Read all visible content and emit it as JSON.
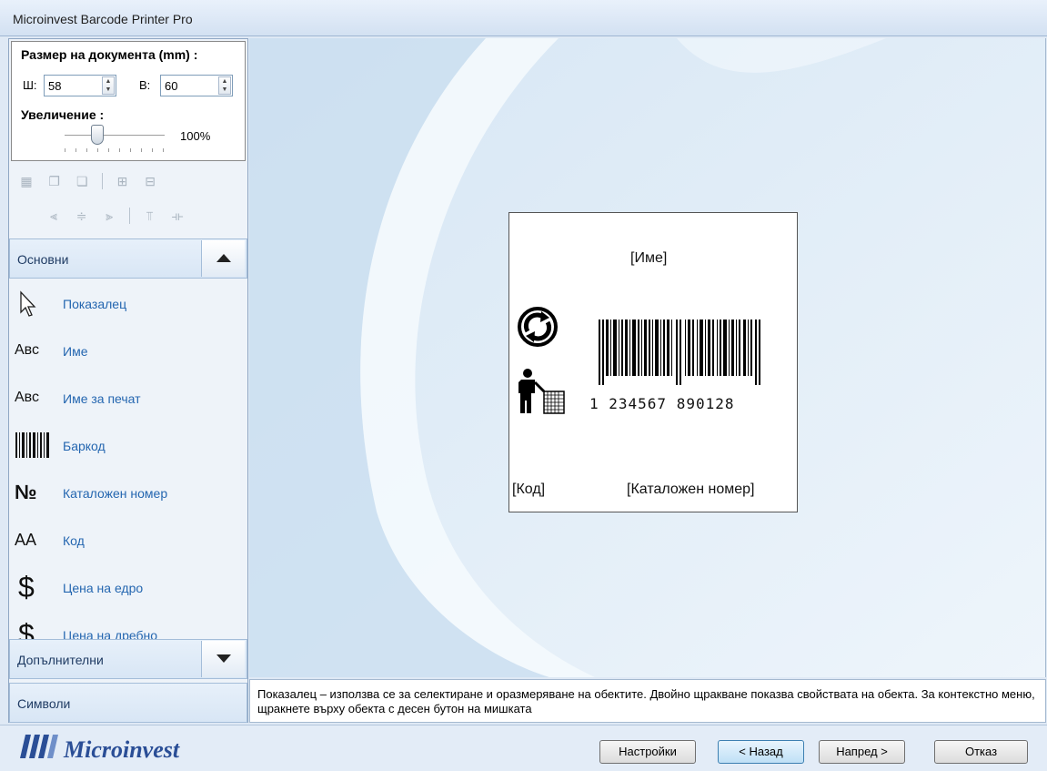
{
  "window": {
    "title": "Microinvest Barcode Printer Pro"
  },
  "doc_size": {
    "title": "Размер на документа (mm) :",
    "width_label": "Ш:",
    "width_value": "58",
    "height_label": "В:",
    "height_value": "60",
    "zoom_label": "Увеличение :",
    "zoom_value_text": "100%",
    "zoom_level": 0.33
  },
  "sections": {
    "basic": "Основни",
    "additional": "Допълнителни",
    "symbols": "Символи"
  },
  "tools": [
    {
      "icon": "pointer-icon",
      "label": "Показалец"
    },
    {
      "icon": "abc-icon",
      "icon_text": "Авс",
      "label": "Име"
    },
    {
      "icon": "abc-icon",
      "icon_text": "Авс",
      "label": "Име за печат"
    },
    {
      "icon": "barcode-icon",
      "label": "Баркод"
    },
    {
      "icon": "numero-icon",
      "icon_text": "№",
      "label": "Каталожен номер"
    },
    {
      "icon": "aa-icon",
      "icon_text": "АА",
      "label": "Код"
    },
    {
      "icon": "dollar-icon",
      "icon_text": "$",
      "label": "Цена на едро"
    },
    {
      "icon": "dollar-icon",
      "icon_text": "$",
      "label": "Цена на дребно"
    }
  ],
  "label_preview": {
    "name": "[Име]",
    "code": "[Код]",
    "catalog": "[Каталожен номер]",
    "barcode_number": "1 234567 890128"
  },
  "hint": "Показалец –  използва се за селектиране и оразмеряване на обектите. Двойно щракване показва свойствата на обекта. За контекстно меню, щракнете върху обекта с десен бутон на мишката",
  "footer": {
    "logo_text": "Microinvest",
    "settings": "Настройки",
    "back": "< Назад",
    "next": "Напред >",
    "cancel": "Отказ"
  }
}
